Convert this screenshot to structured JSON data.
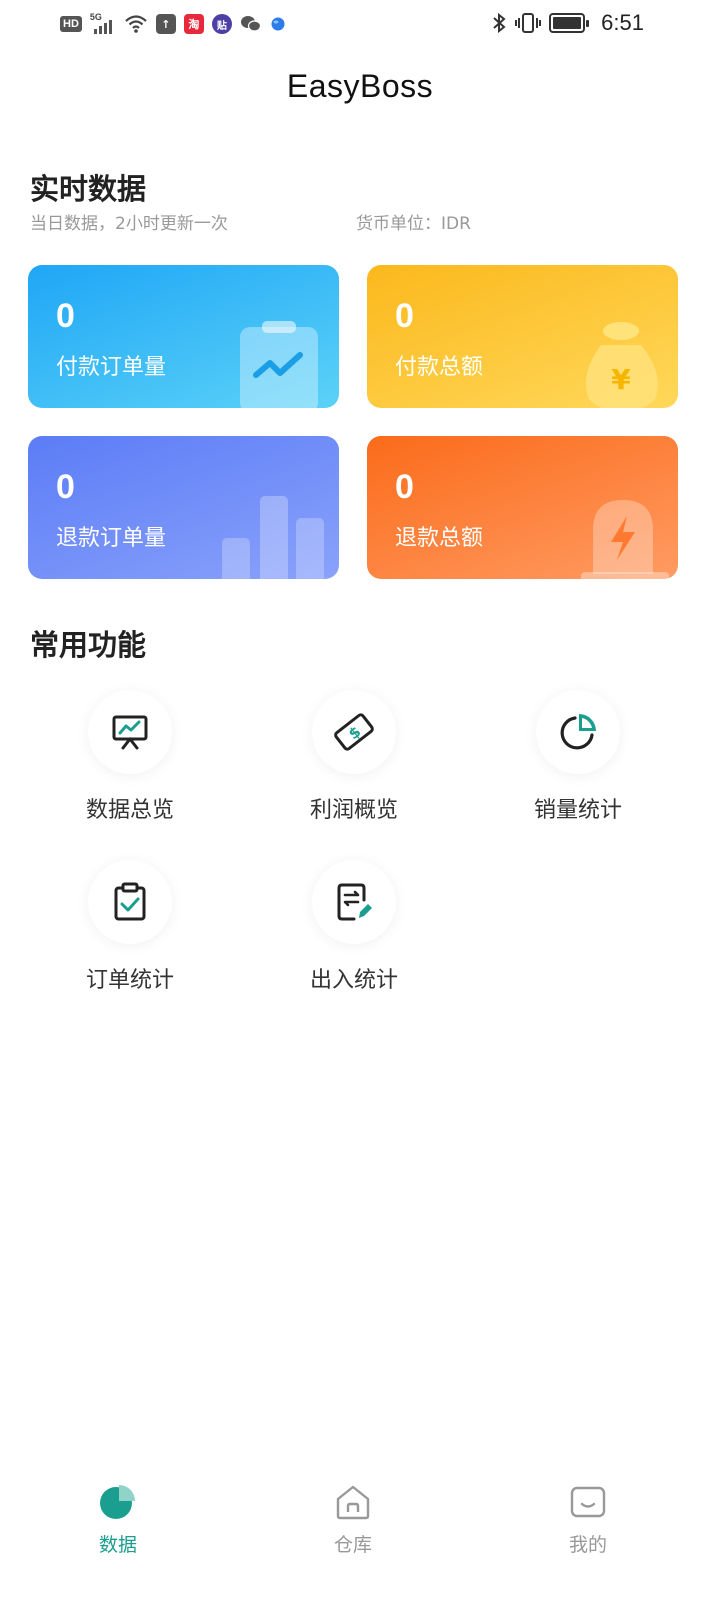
{
  "status_bar": {
    "network": "HD",
    "signal": "5G",
    "time": "6:51",
    "app_icons": [
      {
        "name": "taobao-icon",
        "glyph": "淘",
        "color": "#e8283b"
      },
      {
        "name": "tieba-icon",
        "glyph": "贴",
        "color": "#4d3fa6"
      },
      {
        "name": "wechat-icon",
        "glyph": "",
        "color": "#555555"
      },
      {
        "name": "browser-icon",
        "glyph": "",
        "color": "#2b7de9"
      }
    ]
  },
  "header": {
    "title": "EasyBoss"
  },
  "realtime": {
    "title": "实时数据",
    "subtitle": "当日数据，2小时更新一次",
    "currency": "货币单位：IDR",
    "cards": [
      {
        "value": "0",
        "label": "付款订单量",
        "color": "#1fa6f6"
      },
      {
        "value": "0",
        "label": "付款总额",
        "color": "#fbb81c"
      },
      {
        "value": "0",
        "label": "退款订单量",
        "color": "#5b7cf6"
      },
      {
        "value": "0",
        "label": "退款总额",
        "color": "#fb6b1a"
      }
    ]
  },
  "functions": {
    "title": "常用功能",
    "items": [
      {
        "label": "数据总览",
        "icon": "presentation-chart-icon"
      },
      {
        "label": "利润概览",
        "icon": "money-bill-icon"
      },
      {
        "label": "销量统计",
        "icon": "pie-chart-icon"
      },
      {
        "label": "订单统计",
        "icon": "clipboard-check-icon"
      },
      {
        "label": "出入统计",
        "icon": "document-edit-icon"
      }
    ]
  },
  "bottom_nav": {
    "active_color": "#1a9e8f",
    "inactive_color": "#999999",
    "items": [
      {
        "label": "数据",
        "icon": "pie-chart-icon",
        "active": true
      },
      {
        "label": "仓库",
        "icon": "warehouse-icon",
        "active": false
      },
      {
        "label": "我的",
        "icon": "profile-icon",
        "active": false
      }
    ]
  }
}
